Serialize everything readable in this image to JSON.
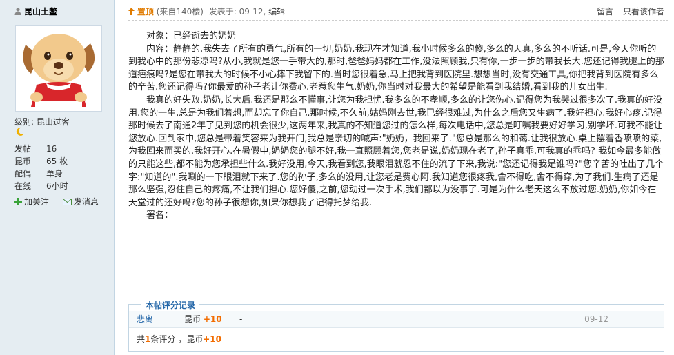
{
  "user": {
    "name": "昆山土鳖",
    "level_label": "级别:",
    "level_value": "昆山过客",
    "stats": [
      {
        "k": "发帖",
        "v": "16"
      },
      {
        "k": "昆币",
        "v": "65 枚"
      },
      {
        "k": "配偶",
        "v": "单身"
      },
      {
        "k": "在线",
        "v": "6小时"
      }
    ],
    "follow_label": "加关注",
    "message_label": "发消息"
  },
  "post": {
    "top_label": "置顶",
    "floor_text": "(来自140楼)",
    "posted_text": "发表于: 09-12",
    "edit_label": "编辑",
    "reply_label": "留言",
    "author_only_label": "只看该作者",
    "paragraphs": [
      "　　对象：已经逝去的奶奶",
      "　　内容：静静的,我失去了所有的勇气,所有的一切,奶奶.我现在才知道,我小时候多么的傻,多么的天真,多么的不听话.可是,今天你听的到我心中的那份悲凉吗?从小,我就是您一手带大的,那时,爸爸妈妈都在工作,没法照顾我,只有你,一步一步的带我长大.您还记得我腿上的那道疤痕吗?是您在带我大的时候不小心摔下我留下的.当时您很着急,马上把我背到医院里.想想当时,没有交通工具,你把我背到医院有多么的辛苦.您还记得吗?你最爱的孙子老让你费心.老惹您生气.奶奶,你当时对我最大的希望是能看到我结婚,看到我的儿女出生.",
      "　　我真的好失败.奶奶,长大后.我还是那么不懂事,让您为我担忧.我多么的不孝顺,多么的让您伤心.记得您为我哭过很多次了.我真的好没用.您的一生,总是为我们着想,而却忘了你自己.那时候,不久前,姑妈刚去世,我已经很难过,为什么之后您又生病了.我好担心.我好心疼.记得那时候去了南通2年了见到您的机会很少,这两年来,我真的不知道您过的怎么样,每次电话中,您总是叮嘱我要好好学习,别学坏.可我不能让您放心.回到家中,您总是带着笑容来为我开门,我总是亲切的喊声:\"奶奶，我回来了.\"您总是那么的和蔼.让我很放心.桌上摆着香喷喷的菜,为我回来而买的.我好开心.在暑假中,奶奶您的腿不好,我一直照顾着您,您老是说,奶奶现在老了,孙子真乖.可我真的乖吗? 我如今最多能做的只能这些,都不能为您承担些什么.我好没用,今天,我看到您,我眼泪就忍不住的流了下来,我说:\"您还记得我是谁吗?\"您辛苦的吐出了几个字:\"知道的\".我唰的一下眼泪就下来了.您的孙子,多么的没用,让您老是费心阿.我知道您很疼我,舍不得吃,舍不得穿,为了我们.生病了还是那么坚强,忍住自己的疼痛,不让我们担心.您好傻,之前,您动过一次手术,我们都以为没事了.可是为什么老天这么不放过您.奶奶,你如今在天堂过的还好吗?您的孙子很想你,如果你想我了记得托梦给我.",
      "　　署名："
    ]
  },
  "rating": {
    "title": "本帖评分记录",
    "items": [
      {
        "who": "悲离",
        "currency": "昆币",
        "value": "+10",
        "reason": "-",
        "date": "09-12"
      }
    ],
    "summary_prefix": "共",
    "summary_count": "1",
    "summary_mid": "条评分 ，昆币",
    "summary_value": "+10"
  },
  "colors": {
    "accent": "#2366a8",
    "orange": "#f26c00",
    "sidebar_bg": "#e5edf2"
  }
}
